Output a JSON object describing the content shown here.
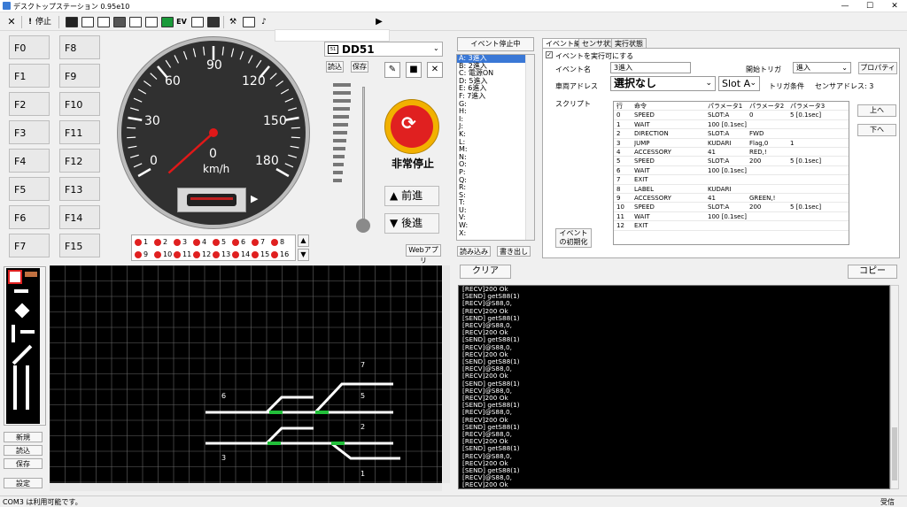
{
  "app": {
    "title": "デスクトップステーション 0.95e10"
  },
  "toolbar": {
    "close_label": "✕",
    "stop_label": "停止"
  },
  "functions": {
    "left": [
      "F0",
      "F1",
      "F2",
      "F3",
      "F4",
      "F5",
      "F6",
      "F7"
    ],
    "right": [
      "F8",
      "F9",
      "F10",
      "F11",
      "F12",
      "F13",
      "F14",
      "F15"
    ]
  },
  "speedometer": {
    "ticks": [
      "0",
      "30",
      "60",
      "90",
      "120",
      "150",
      "180"
    ],
    "center_value": "0",
    "unit": "km/h",
    "speed": 0
  },
  "loco": {
    "name": "DD51",
    "load_label": "読込",
    "save_label": "保存",
    "emergency_label": "非常停止",
    "forward_label": "前進",
    "backward_label": "後進",
    "webapp_label": "Webアプリ"
  },
  "function_leds": {
    "row1": [
      "1",
      "2",
      "3",
      "4",
      "5",
      "6",
      "7",
      "8"
    ],
    "row2": [
      "9",
      "10",
      "11",
      "12",
      "13",
      "14",
      "15",
      "16"
    ]
  },
  "event_list": {
    "header": "イベント停止中",
    "items": [
      "A: 3進入",
      "B: 2進入",
      "C: 電源ON",
      "D: 5進入",
      "E: 6進入",
      "F: 7進入",
      "G:",
      "H:",
      "I:",
      "J:",
      "K:",
      "L:",
      "M:",
      "N:",
      "O:",
      "P:",
      "Q:",
      "R:",
      "S:",
      "T:",
      "U:",
      "V:",
      "W:",
      "X:"
    ],
    "read_label": "読み込み",
    "write_label": "書き出し"
  },
  "event_editor": {
    "tabs": [
      "イベント編集",
      "センサ状態",
      "実行状態"
    ],
    "enable_label": "イベントを実行可にする",
    "name_label": "イベント名",
    "name_value": "3進入",
    "trigger_label": "開始トリガ",
    "trigger_value": "進入",
    "property_label": "プロパティ",
    "address_label": "車両アドレス",
    "address_value": "選択なし",
    "slot_value": "Slot A",
    "trigger_cond_label": "トリガ条件",
    "sensor_label": "センサアドレス: 3",
    "script_label": "スクリプト",
    "up_label": "上へ",
    "down_label": "下へ",
    "init_label": "イベントの初期化",
    "columns": [
      "行",
      "命令",
      "パラメータ1",
      "パラメータ2",
      "パラメータ3"
    ],
    "rows": [
      [
        "0",
        "SPEED",
        "SLOT:A",
        "0",
        "5 [0.1sec]"
      ],
      [
        "1",
        "WAIT",
        "100 [0.1sec]",
        "",
        ""
      ],
      [
        "2",
        "DIRECTION",
        "SLOT:A",
        "FWD",
        ""
      ],
      [
        "3",
        "JUMP",
        "KUDARI",
        "Flag,0",
        "1"
      ],
      [
        "4",
        "ACCESSORY",
        "41",
        "RED,!",
        ""
      ],
      [
        "5",
        "SPEED",
        "SLOT:A",
        "200",
        "5 [0.1sec]"
      ],
      [
        "6",
        "WAIT",
        "100 [0.1sec]",
        "",
        ""
      ],
      [
        "7",
        "EXIT",
        "",
        "",
        ""
      ],
      [
        "8",
        "LABEL",
        "KUDARI",
        "",
        ""
      ],
      [
        "9",
        "ACCESSORY",
        "41",
        "GREEN,!",
        ""
      ],
      [
        "10",
        "SPEED",
        "SLOT:A",
        "200",
        "5 [0.1sec]"
      ],
      [
        "11",
        "WAIT",
        "100 [0.1sec]",
        "",
        ""
      ],
      [
        "12",
        "EXIT",
        "",
        "",
        ""
      ]
    ]
  },
  "layout_panel": {
    "new_label": "新規",
    "load_label": "読込",
    "save_label": "保存",
    "settings_label": "設定",
    "track_labels": [
      "7",
      "6",
      "5",
      "2",
      "3",
      "1"
    ]
  },
  "console": {
    "clear_label": "クリア",
    "copy_label": "コピー",
    "lines": [
      "[RECV]200 Ok",
      "[SEND] getS88(1)",
      "[RECV]@S88,0,",
      "[RECV]200 Ok",
      "[SEND] getS88(1)",
      "[RECV]@S88,0,",
      "[RECV]200 Ok",
      "[SEND] getS88(1)",
      "[RECV]@S88,0,",
      "[RECV]200 Ok",
      "[SEND] getS88(1)",
      "[RECV]@S88,0,",
      "[RECV]200 Ok",
      "[SEND] getS88(1)",
      "[RECV]@S88,0,",
      "[RECV]200 Ok",
      "[SEND] getS88(1)",
      "[RECV]@S88,0,",
      "[RECV]200 Ok",
      "[SEND] getS88(1)",
      "[RECV]@S88,0,",
      "[RECV]200 Ok",
      "[SEND] getS88(1)",
      "[RECV]@S88,0,",
      "[RECV]200 Ok",
      "[SEND] getS88(1)",
      "[RECV]@S88,0,",
      "[RECV]200 Ok"
    ]
  },
  "status": {
    "left": "COM3 は利用可能です。",
    "right": "受信"
  }
}
